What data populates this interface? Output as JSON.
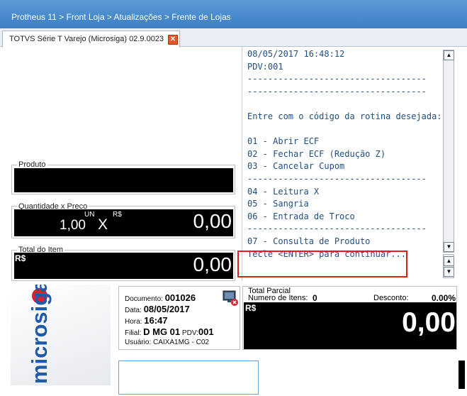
{
  "breadcrumb": "Protheus 11 > Front Loja > Atualizações > Frente de Lojas",
  "tab": {
    "label": "TOTVS Série T Varejo (Microsiga) 02.9.0023",
    "close": "✕"
  },
  "produto": {
    "title": "Produto",
    "value": ""
  },
  "quantidade_preco": {
    "title": "Quantidade x Preco",
    "unit": "UN",
    "quantity": "1,00",
    "times": "X",
    "currency": "R$",
    "price": "0,00"
  },
  "total_item": {
    "title": "Total do Item",
    "currency": "R$",
    "value": "0,00"
  },
  "terminal": {
    "lines": [
      "08/05/2017 16:48:12",
      "PDV:001",
      "-----------------------------------",
      "-----------------------------------",
      "",
      "Entre com o código da rotina desejada:",
      "",
      "01 - Abrir ECF",
      "02 - Fechar ECF (Redução Z)",
      "03 - Cancelar Cupom",
      "-----------------------------------",
      "04 - Leitura X",
      "05 - Sangria",
      "06 - Entrada de Troco",
      "-----------------------------------",
      "07 - Consulta de Produto",
      "Tecle <ENTER> para continuar..."
    ],
    "scroll_up": "▲",
    "scroll_down": "▼"
  },
  "logo": {
    "text": "microsiga",
    "color": "#1e5aa8"
  },
  "documento": {
    "documento_label": "Documento:",
    "documento_value": "001026",
    "data_label": "Data:",
    "data_value": "08/05/2017",
    "hora_label": "Hora:",
    "hora_value": "16:47",
    "filial_label": "Filial:",
    "filial_value": "D MG 01",
    "pdv_label": "PDV:",
    "pdv_value": "001",
    "usuario_label": "Usuário:",
    "usuario_value": "CAIXA1MG - C02"
  },
  "total_parcial": {
    "title": "Total Parcial",
    "itens_label": "Numero de Itens:",
    "itens_value": "0",
    "desconto_label": "Desconto:",
    "desconto_value": "0.00%",
    "currency": "R$",
    "value": "0,00"
  },
  "colors": {
    "header_blue": "#3c7fc4",
    "terminal_text": "#1f4f80",
    "highlight_red": "#e01e1e"
  }
}
